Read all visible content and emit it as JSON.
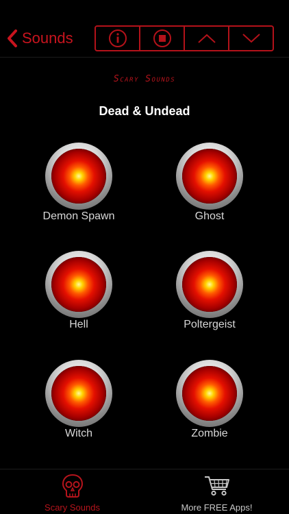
{
  "navbar": {
    "back_label": "Sounds",
    "accent_color": "#c8141e",
    "controls": [
      {
        "icon": "info-icon"
      },
      {
        "icon": "stop-icon"
      },
      {
        "icon": "chevron-up-icon"
      },
      {
        "icon": "chevron-down-icon"
      }
    ]
  },
  "brand": "Scary Sounds",
  "category_title": "Dead & Undead",
  "sounds": [
    {
      "label": "Demon Spawn"
    },
    {
      "label": "Ghost"
    },
    {
      "label": "Hell"
    },
    {
      "label": "Poltergeist"
    },
    {
      "label": "Witch"
    },
    {
      "label": "Zombie"
    }
  ],
  "tabbar": {
    "tabs": [
      {
        "label": "Scary Sounds",
        "icon": "skull-icon",
        "active": true
      },
      {
        "label": "More FREE Apps!",
        "icon": "cart-icon",
        "active": false
      }
    ]
  }
}
